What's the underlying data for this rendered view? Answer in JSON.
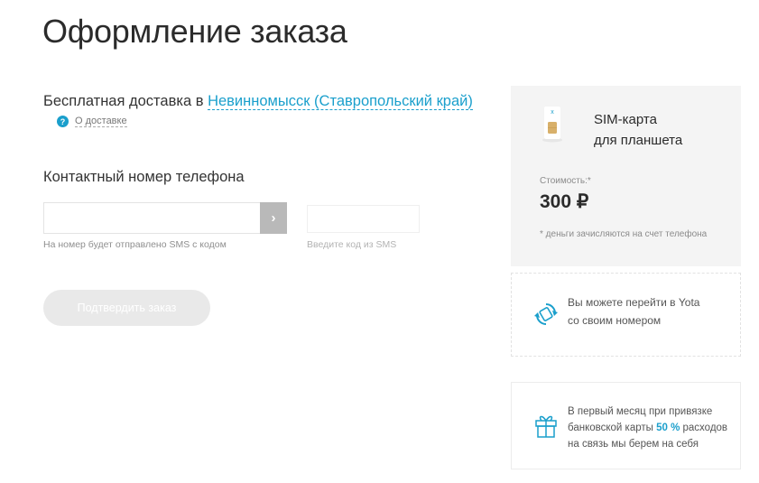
{
  "page": {
    "title": "Оформление заказа"
  },
  "delivery": {
    "prefix": "Бесплатная доставка в ",
    "city": "Невинномысск (Ставропольский край)",
    "about_icon": "?",
    "about_label": "О доставке"
  },
  "contact": {
    "title": "Контактный номер телефона",
    "phone_value": "",
    "go_icon": "›",
    "phone_hint": "На номер будет отправлено SMS с кодом",
    "code_value": "",
    "code_hint": "Введите код из SMS"
  },
  "confirm_label": "Подтвердить заказ",
  "order_card": {
    "product_line1": "SIM-карта",
    "product_line2": "для планшета",
    "price_label": "Стоимость:*",
    "price": "300 ₽",
    "note": "* деньги зачисляются на счет телефона",
    "sim_icon": "sim-card-icon"
  },
  "promos": {
    "move": {
      "icon": "number-transfer-icon",
      "line1": "Вы можете перейти в Yota",
      "line2": "со своим номером"
    },
    "bonus": {
      "icon": "gift-icon",
      "line1": "В первый месяц при привязке",
      "line2_prefix": "банковской карты ",
      "line2_highlight": "50 %",
      "line2_suffix": " расходов",
      "line3": "на связь мы берем на себя"
    }
  },
  "colors": {
    "accent": "#1a9fcc",
    "button_disabled": "#e9e9e9",
    "go_button": "#b9b9b9",
    "card_bg": "#f4f4f4"
  }
}
